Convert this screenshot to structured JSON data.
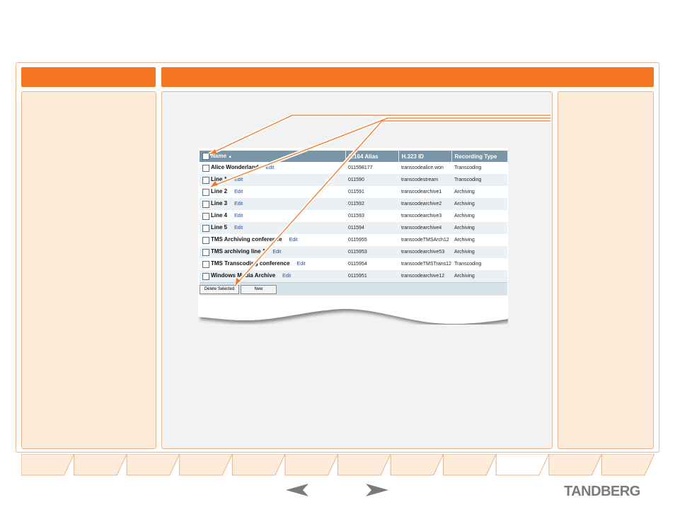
{
  "table": {
    "headers": [
      "Name",
      "E.164 Alias",
      "H.323 ID",
      "Recording Type"
    ],
    "rows": [
      {
        "name": "Alice Wonderland",
        "edit": "Edit",
        "alias": "011598177",
        "h323": "transcodealice.won",
        "type": "Transcoding"
      },
      {
        "name": "Line 1",
        "edit": "Edit",
        "alias": "011590",
        "h323": "transcodestream",
        "type": "Transcoding"
      },
      {
        "name": "Line 2",
        "edit": "Edit",
        "alias": "011591",
        "h323": "transcodearchive1",
        "type": "Archiving"
      },
      {
        "name": "Line 3",
        "edit": "Edit",
        "alias": "011592",
        "h323": "transcodearchive2",
        "type": "Archiving"
      },
      {
        "name": "Line 4",
        "edit": "Edit",
        "alias": "011593",
        "h323": "transcodearchive3",
        "type": "Archiving"
      },
      {
        "name": "Line 5",
        "edit": "Edit",
        "alias": "011594",
        "h323": "transcodearchive4",
        "type": "Archiving"
      },
      {
        "name": "TMS Archiving conference",
        "edit": "Edit",
        "alias": "0115955",
        "h323": "transcodeTMSArch12",
        "type": "Archiving"
      },
      {
        "name": "TMS archiving line 1",
        "edit": "Edit",
        "alias": "0115953",
        "h323": "transcodearchive53",
        "type": "Archiving"
      },
      {
        "name": "TMS Transcoding conference",
        "edit": "Edit",
        "alias": "0115954",
        "h323": "transcodeTMSTrans12",
        "type": "Transcoding"
      },
      {
        "name": "Windows Media Archive",
        "edit": "Edit",
        "alias": "0115951",
        "h323": "transcodearchive12",
        "type": "Archiving"
      }
    ]
  },
  "buttons": {
    "delete": "Delete Selected",
    "new": "New"
  },
  "logo": "TANDBERG",
  "colors": {
    "accent": "#f47621",
    "header_bg": "#7996a7",
    "side_bg": "#fdecd9"
  },
  "nav": {
    "prev_icon": "left-arrow-icon",
    "next_icon": "right-arrow-icon"
  }
}
